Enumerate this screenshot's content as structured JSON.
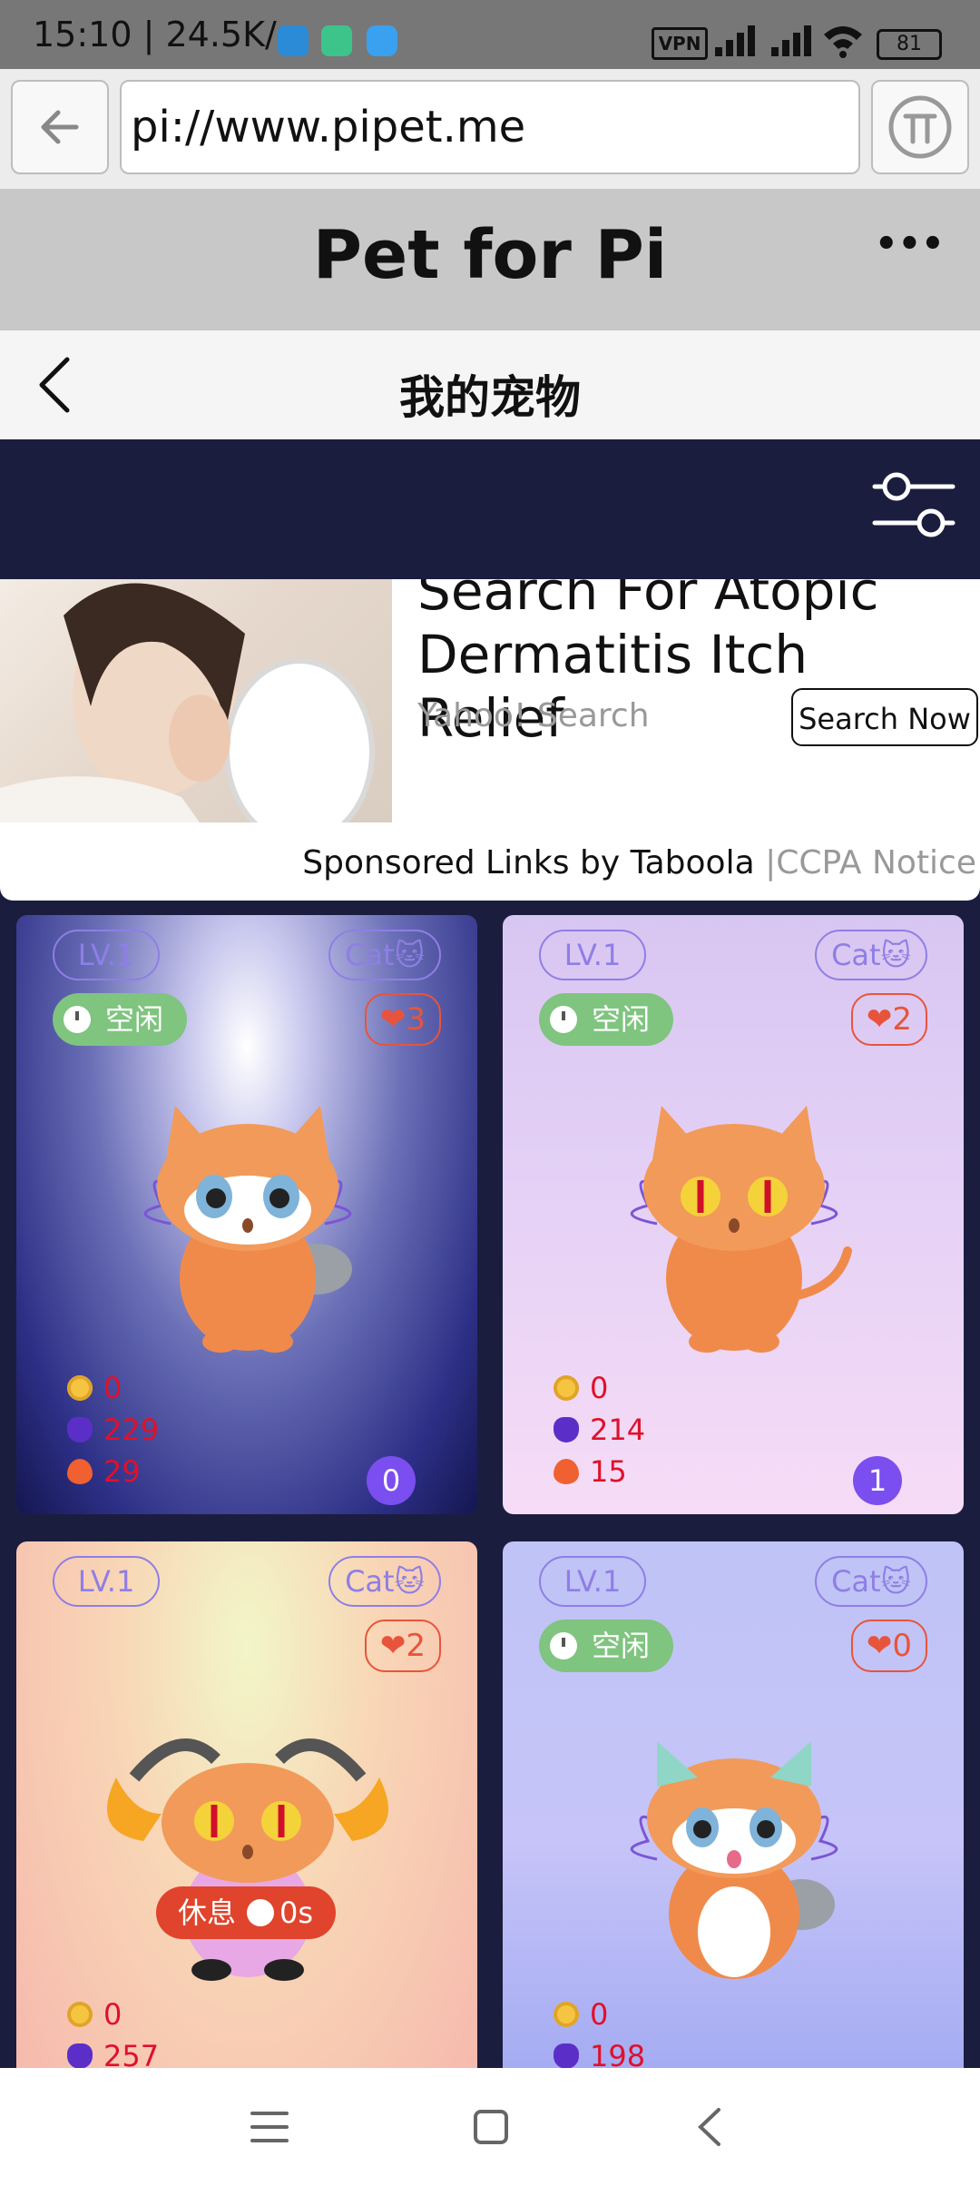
{
  "status_bar": {
    "time": "15:10",
    "speed": "24.5K/s",
    "vpn": "VPN",
    "battery": "81"
  },
  "browser": {
    "url": "pi://www.pipet.me"
  },
  "site": {
    "title": "Pet for Pi",
    "menu": "•••"
  },
  "page": {
    "title": "我的宠物"
  },
  "ad": {
    "headline": "Search For Atopic Dermatitis Itch Relief",
    "source": "Yahoo! Search",
    "cta": "Search Now",
    "footer": "Sponsored Links by Taboola",
    "separator": "|",
    "ccpa": "CCPA Notice"
  },
  "pets": [
    {
      "level": "LV.1",
      "type": "Cat🐱",
      "status": "空闲",
      "hearts": "3",
      "coins": "0",
      "power": "229",
      "fire": "29",
      "badge": "0"
    },
    {
      "level": "LV.1",
      "type": "Cat🐱",
      "status": "空闲",
      "hearts": "2",
      "coins": "0",
      "power": "214",
      "fire": "15",
      "badge": "1"
    },
    {
      "level": "LV.1",
      "type": "Cat🐱",
      "rest_label": "休息",
      "rest_time": "0s",
      "hearts": "2",
      "coins": "0",
      "power": "257"
    },
    {
      "level": "LV.1",
      "type": "Cat🐱",
      "status": "空闲",
      "hearts": "0",
      "coins": "0",
      "power": "198"
    }
  ],
  "colors": {
    "accent": "#7b4ef0",
    "heart": "#e8543b",
    "idle": "#7fc47f",
    "rest": "#e0442c",
    "dark": "#1b1d3f"
  }
}
